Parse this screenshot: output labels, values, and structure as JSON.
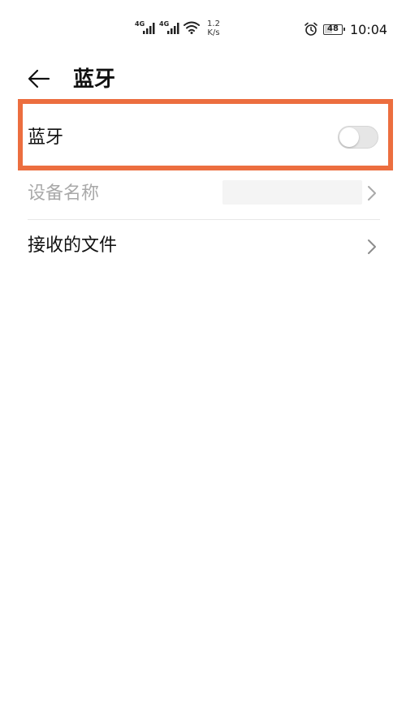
{
  "status_bar": {
    "network_type_1": "4G",
    "network_type_2": "4G",
    "speed_value": "1.2",
    "speed_unit": "K/s",
    "battery_level": "48",
    "time": "10:04",
    "icons": [
      "signal-icon",
      "signal-icon",
      "wifi-icon",
      "alarm-icon",
      "battery-icon"
    ]
  },
  "header": {
    "back_icon": "arrow-left-icon",
    "title": "蓝牙"
  },
  "settings": {
    "bluetooth": {
      "label": "蓝牙",
      "enabled": false
    },
    "device_name": {
      "label": "设备名称",
      "chevron_icon": "chevron-right-icon"
    },
    "received_files": {
      "label": "接收的文件",
      "chevron_icon": "chevron-right-icon"
    }
  },
  "colors": {
    "highlight": "#ec6e3f",
    "toggle_off": "#e6e6e6",
    "disabled_text": "#a9a9a9"
  }
}
